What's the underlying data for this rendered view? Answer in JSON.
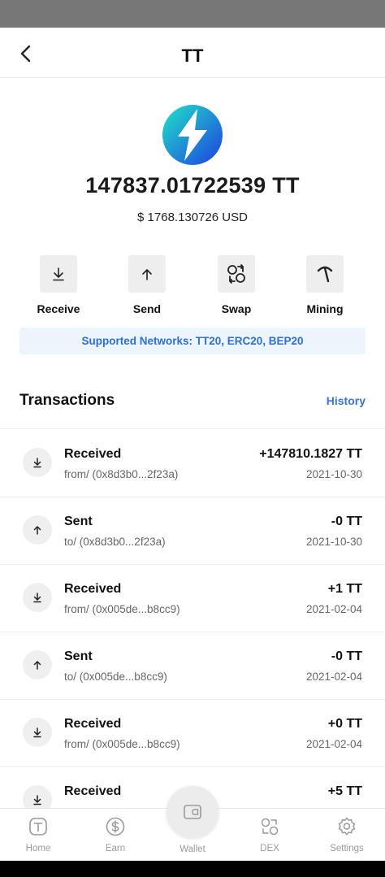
{
  "header": {
    "title": "TT"
  },
  "token": {
    "balance": "147837.01722539  TT",
    "fiat_value": "$ 1768.130726 USD",
    "logo_icon": "lightning-bolt-icon",
    "logo_gradient": [
      "#22e3c8",
      "#1d3fe0"
    ]
  },
  "actions": [
    {
      "label": "Receive",
      "icon": "arrow-down-icon"
    },
    {
      "label": "Send",
      "icon": "arrow-up-icon"
    },
    {
      "label": "Swap",
      "icon": "swap-icon"
    },
    {
      "label": "Mining",
      "icon": "pickaxe-icon"
    }
  ],
  "networks_banner": "Supported Networks: TT20, ERC20, BEP20",
  "transactions": {
    "title": "Transactions",
    "history_label": "History",
    "items": [
      {
        "type": "Received",
        "address": "from/ (0x8d3b0...2f23a)",
        "amount": "+147810.1827 TT",
        "date": "2021-10-30",
        "direction": "in"
      },
      {
        "type": "Sent",
        "address": "to/ (0x8d3b0...2f23a)",
        "amount": "-0 TT",
        "date": "2021-10-30",
        "direction": "out"
      },
      {
        "type": "Received",
        "address": "from/ (0x005de...b8cc9)",
        "amount": "+1 TT",
        "date": "2021-02-04",
        "direction": "in"
      },
      {
        "type": "Sent",
        "address": "to/ (0x005de...b8cc9)",
        "amount": "-0 TT",
        "date": "2021-02-04",
        "direction": "out"
      },
      {
        "type": "Received",
        "address": "from/ (0x005de...b8cc9)",
        "amount": "+0 TT",
        "date": "2021-02-04",
        "direction": "in"
      },
      {
        "type": "Received",
        "address": "",
        "amount": "+5 TT",
        "date": "",
        "direction": "in"
      }
    ]
  },
  "tab_bar": {
    "tabs": [
      {
        "label": "Home",
        "icon": "home-icon"
      },
      {
        "label": "Earn",
        "icon": "dollar-icon"
      },
      {
        "label": "Wallet",
        "icon": "wallet-icon"
      },
      {
        "label": "DEX",
        "icon": "dex-icon"
      },
      {
        "label": "Settings",
        "icon": "gear-icon"
      }
    ],
    "active": "Wallet"
  },
  "colors": {
    "accent": "#3a73d8",
    "banner_bg": "#ecf4fc",
    "status_bar": "#777777"
  }
}
